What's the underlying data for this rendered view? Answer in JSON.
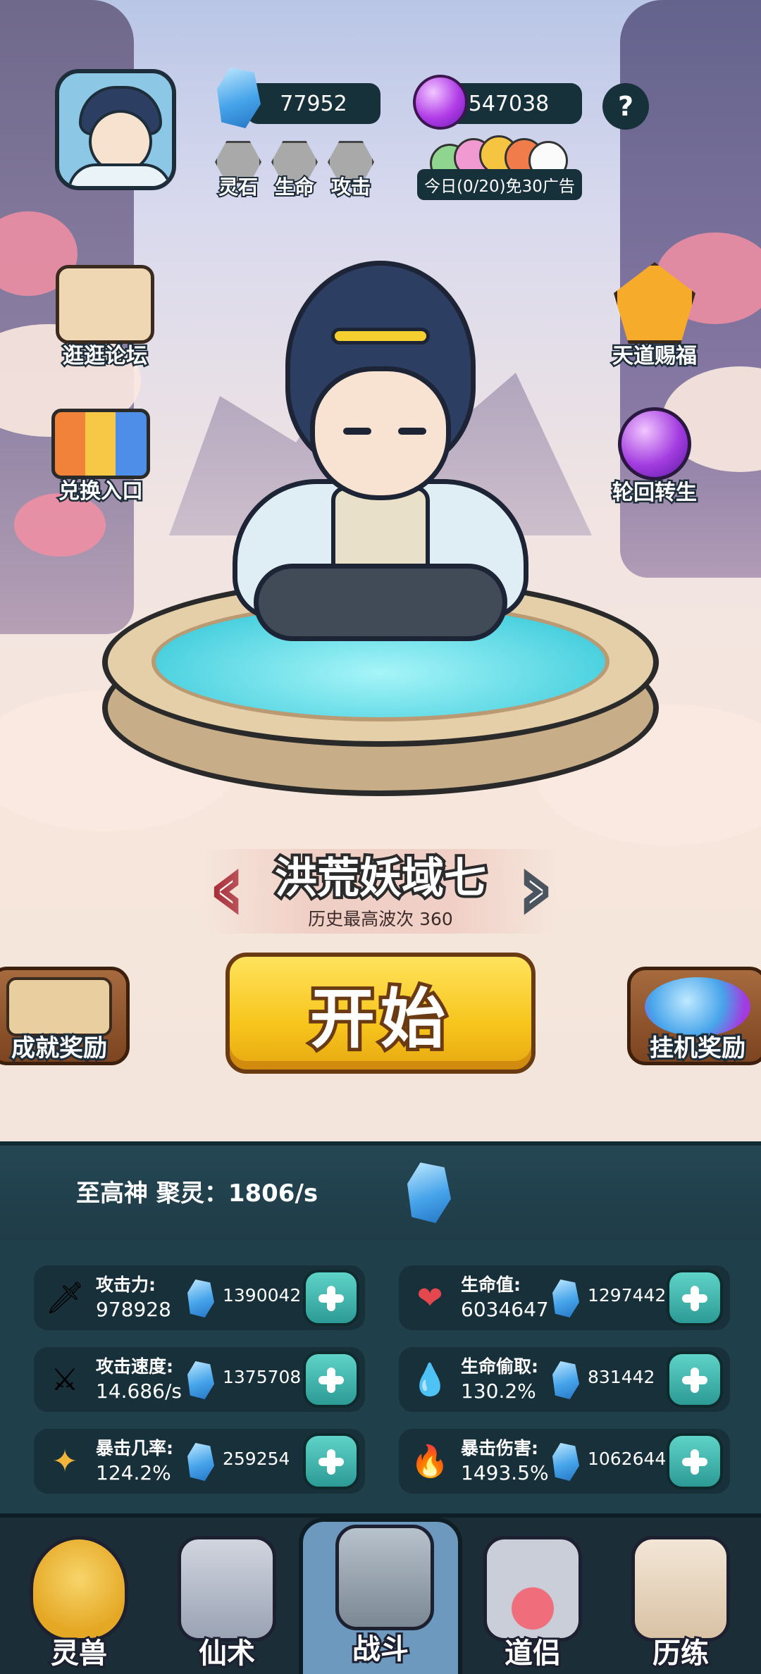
{
  "top": {
    "spirit_stones": "77952",
    "purple_gems": "547038",
    "help_label": "?",
    "stat_chips": [
      "灵石",
      "生命",
      "攻击"
    ],
    "ad_text": "今日(0/20)免30广告"
  },
  "side": {
    "forum": "逛逛论坛",
    "exchange": "兑换入口",
    "blessing": "天道赐福",
    "rebirth": "轮回转生"
  },
  "stage": {
    "name": "洪荒妖域七",
    "best_wave": "历史最高波次 360",
    "prev_arrow": "‹",
    "next_arrow": "›"
  },
  "actions": {
    "start": "开始",
    "achievement": "成就奖励",
    "idle": "挂机奖励"
  },
  "gather": {
    "text": "至高神 聚灵：1806/s"
  },
  "stats": [
    {
      "name": "攻击力:",
      "value": "978928",
      "cost": "1390042"
    },
    {
      "name": "生命值:",
      "value": "6034647",
      "cost": "1297442"
    },
    {
      "name": "攻击速度:",
      "value": "14.686/s",
      "cost": "1375708"
    },
    {
      "name": "生命偷取:",
      "value": "130.2%",
      "cost": "831442"
    },
    {
      "name": "暴击几率:",
      "value": "124.2%",
      "cost": "259254"
    },
    {
      "name": "暴击伤害:",
      "value": "1493.5%",
      "cost": "1062644"
    }
  ],
  "tabs": [
    "灵兽",
    "仙术",
    "战斗",
    "道侣",
    "历练"
  ],
  "colors": {
    "panel": "#1f3f4b",
    "start_button": "#f7c51c",
    "plus_button": "#2c9a95",
    "active_tab": "#6e99bf"
  }
}
